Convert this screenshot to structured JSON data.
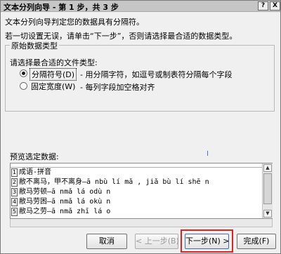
{
  "titlebar": {
    "title": "文本分列向导 - 第 1 步，共 3 步",
    "help_glyph": "?",
    "close_glyph": "X"
  },
  "intro": {
    "line1": "文本分列向导判定您的数据具有分隔符。",
    "line2": "若一切设置无误，请单击“下一步”，否则请选择最合适的数据类型。"
  },
  "group": {
    "legend": "原始数据类型",
    "prompt": "请选择最合适的文件类型:",
    "options": [
      {
        "label": "分隔符号(D)",
        "description": "- 用分隔字符，如逗号或制表符分隔每个字段",
        "selected": true
      },
      {
        "label": "固定宽度(W)",
        "description": "- 每列字段加空格对齐",
        "selected": false
      }
    ]
  },
  "preview": {
    "label": "预览选定数据:",
    "rows": [
      {
        "num": "1",
        "text": "成语-拼音"
      },
      {
        "num": "2",
        "text": "敝不离马，甲不离身—ā nbù lí mǎ , jiǎ bù lí shē n"
      },
      {
        "num": "3",
        "text": "敝马劳顿—ā nmǎ lá odù n"
      },
      {
        "num": "4",
        "text": "敝马劳困—ā nmǎ lá okù n"
      },
      {
        "num": "5",
        "text": "敝马之劳—ā nmǎ zhī lá o"
      }
    ]
  },
  "buttons": {
    "cancel": "取消",
    "back": "< 上一步(B)",
    "next": "下一步(N) >",
    "finish": "完成(F)"
  },
  "colors": {
    "highlight": "#e2231a",
    "titlebar": "#c6c6c6",
    "dialog_bg": "#f0f0f0"
  }
}
